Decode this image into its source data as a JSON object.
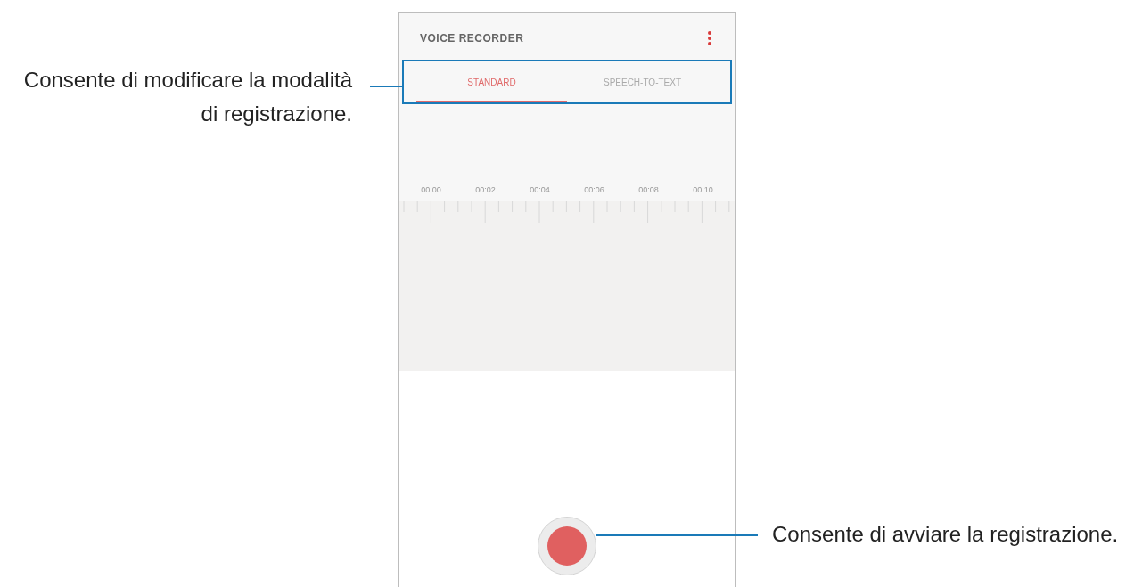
{
  "app": {
    "title": "VOICE RECORDER"
  },
  "tabs": [
    {
      "label": "STANDARD",
      "selected": true
    },
    {
      "label": "SPEECH-TO-TEXT",
      "selected": false
    }
  ],
  "timeline": [
    "00:00",
    "00:02",
    "00:04",
    "00:06",
    "00:08",
    "00:10"
  ],
  "mode_callout": {
    "text": "Consente di modificare la modalità di registrazione."
  },
  "record_callout": {
    "text": "Consente di avviare la registrazione."
  }
}
